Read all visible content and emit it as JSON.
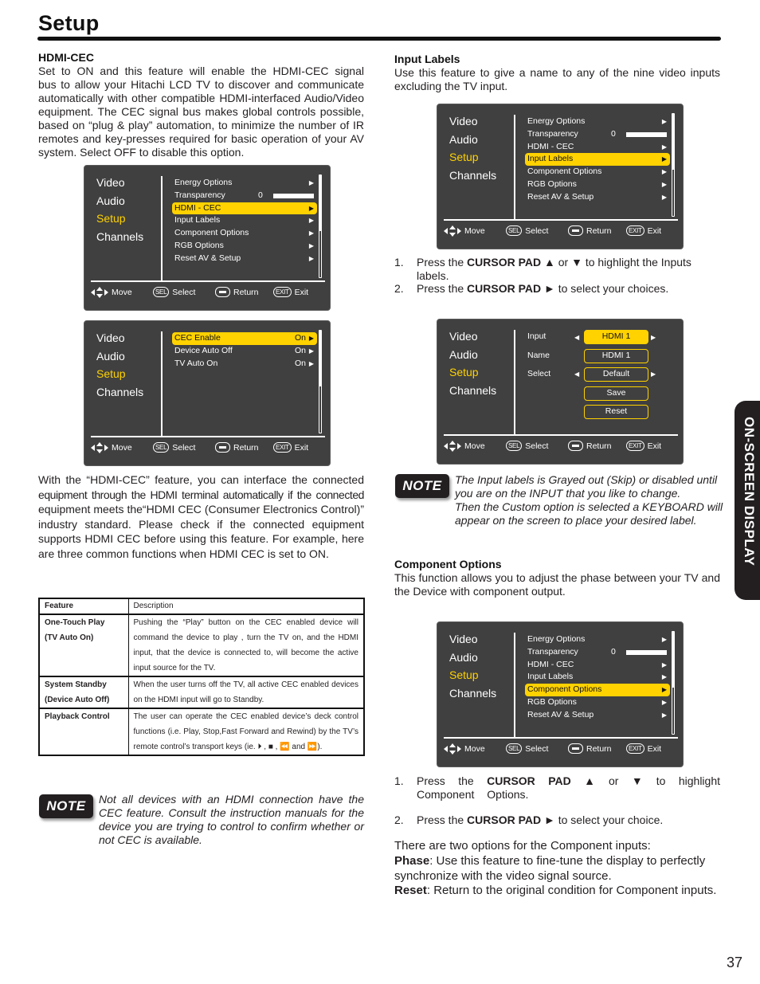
{
  "page": {
    "title": "Setup",
    "page_number": "37",
    "side_tab": "ON-SCREEN DISPLAY"
  },
  "osd_common": {
    "categories": [
      "Video",
      "Audio",
      "Setup",
      "Channels"
    ],
    "active_category": "Setup",
    "footer": {
      "move_label": "Move",
      "select_key": "SEL",
      "select_label": "Select",
      "return_label": "Return",
      "exit_key": "EXIT",
      "exit_label": "Exit"
    }
  },
  "setup_menu_items": [
    "Energy Options",
    "Transparency",
    "HDMI - CEC",
    "Input Labels",
    "Component Options",
    "RGB Options",
    "Reset AV & Setup"
  ],
  "transparency_value": "0",
  "hdmi_cec": {
    "heading": "HDMI-CEC",
    "intro_lines": [
      "Set to ON and this feature will enable the HDMI-CEC signal",
      "bus to allow your Hitachi LCD TV to discover and communicate",
      "automatically with other compatible HDMI-interfaced Audio/Video",
      "equipment. The CEC signal bus makes global controls possible,",
      "based on “plug & play” automation, to minimize the number of IR",
      "remotes and key-presses required for basic operation of your AV",
      "system. Select OFF to disable this option."
    ],
    "menu1_highlight": "HDMI - CEC",
    "submenu": [
      {
        "label": "CEC Enable",
        "value": "On",
        "highlighted": true
      },
      {
        "label": "Device Auto Off",
        "value": "On",
        "highlighted": false
      },
      {
        "label": "TV Auto On",
        "value": "On",
        "highlighted": false
      }
    ],
    "body_lines": [
      "With the “HDMI-CEC” feature, you can interface the connected",
      "equipment through the HDMI terminal automatically if the connected",
      "equipment meets the“HDMI CEC (Consumer Electronics Control)”",
      "industry standard. Please check if the connected equipment",
      "supports HDMI CEC before using this feature. For example, here",
      "are three common functions when HDMI CEC is set to ON."
    ],
    "table": {
      "headers": [
        "Feature",
        "Description"
      ],
      "rows": [
        {
          "feature": [
            "One-Touch Play",
            "(TV Auto On)"
          ],
          "description": "Pushing the “Play” button on the CEC enabled device will command the device to play , turn the TV on, and the HDMI input, that the device is connected to, will become the active input source for the TV."
        },
        {
          "feature": [
            "System Standby",
            "(Device Auto Off)"
          ],
          "description": "When the user turns off the TV, all active CEC enabled devices on the HDMI input will go to Standby."
        },
        {
          "feature": [
            "Playback Control"
          ],
          "description": "The user can operate the CEC enabled device’s deck control functions (i.e. Play, Stop,Fast Forward and Rewind) by the TV’s remote control’s transport keys (ie. ⏵ , ■ , ⏪ and ⏩)."
        }
      ]
    },
    "note_label": "NOTE",
    "note_text": "Not all devices with an HDMI connection have the CEC feature. Consult the instruction manuals for the device you are trying to control to confirm whether or not CEC is available."
  },
  "input_labels": {
    "heading": "Input Labels",
    "intro": "Use this feature to give a name to any of the nine video inputs excluding the TV input.",
    "menu_highlight": "Input Labels",
    "steps": [
      {
        "num": "1.",
        "pre": "Press the ",
        "bold": "CURSOR PAD",
        "post": " ▲ or ▼ to highlight the Inputs labels."
      },
      {
        "num": "2.",
        "pre": "Press the ",
        "bold": "CURSOR PAD",
        "post": " ► to select your choices."
      }
    ],
    "panel": {
      "input_label": "Input",
      "input_value": "HDMI 1",
      "name_label": "Name",
      "name_value": "HDMI 1",
      "select_label": "Select",
      "select_value": "Default",
      "save_button": "Save",
      "reset_button": "Reset"
    },
    "note_label": "NOTE",
    "note_lines": [
      "The Input labels is Grayed out (Skip) or disabled until",
      "you are on the INPUT that you like to change.",
      "Then the Custom option is selected a KEYBOARD will",
      "appear on the screen to place your desired label."
    ]
  },
  "component_options": {
    "heading": "Component Options",
    "intro": "This function allows you to adjust the phase between your TV  and the Device with component output.",
    "menu_highlight": "Component Options",
    "steps": [
      {
        "num": "1.",
        "pre": "Press the ",
        "bold": "CURSOR PAD",
        "post": " ▲ or ▼ to highlight Component Options."
      },
      {
        "num": "2.",
        "pre": "Press the ",
        "bold": "CURSOR PAD",
        "post": "  ► to select your choice."
      }
    ],
    "options_intro": "There are two options for the Component inputs:",
    "options": [
      {
        "name": "Phase",
        "text": ": Use this feature to fine-tune the display to perfectly synchronize with the video signal source."
      },
      {
        "name": "Reset",
        "text": ": Return to the  original condition for Component inputs."
      }
    ]
  },
  "colors": {
    "osd_bg": "#404040",
    "highlight": "#ffd200",
    "text": "#231f20"
  }
}
